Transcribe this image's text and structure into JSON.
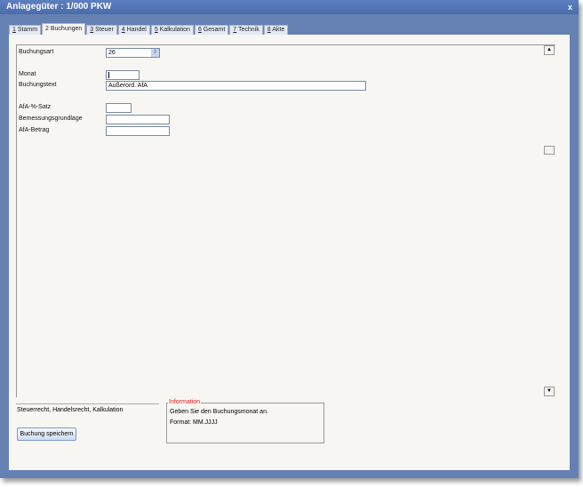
{
  "window": {
    "title": "Anlagegüter : 1/000 PKW",
    "close": "x"
  },
  "tabs": [
    {
      "key": "1",
      "label": " Stamm"
    },
    {
      "key": "",
      "label": "2 Buchungen"
    },
    {
      "key": "3",
      "label": " Steuer"
    },
    {
      "key": "4",
      "label": " Handel"
    },
    {
      "key": "5",
      "label": " Kalkulation"
    },
    {
      "key": "6",
      "label": " Gesamt"
    },
    {
      "key": "7",
      "label": " Technik"
    },
    {
      "key": "8",
      "label": " Akte"
    }
  ],
  "active_tab": "2 Buchungen",
  "form": {
    "buchungsart": {
      "label": "Buchungsart",
      "value": "26"
    },
    "monat": {
      "label": "Monat",
      "value": ""
    },
    "buchungstext": {
      "label": "Buchungstext",
      "value": "Außerord. AfA"
    },
    "afa_satz": {
      "label": "AfA-%-Satz",
      "value": ""
    },
    "bemessung": {
      "label": "Bemessungsgrundlage",
      "value": ""
    },
    "afa_betrag": {
      "label": "AfA-Betrag",
      "value": ""
    }
  },
  "law_scope": "Steuerrecht, Handelsrecht, Kalkulation",
  "save_button": "Buchung speichern",
  "info": {
    "title": "Information",
    "line1": "Geben Sie den Buchungsmonat an.",
    "line2": "Format: MM.JJJJ"
  }
}
